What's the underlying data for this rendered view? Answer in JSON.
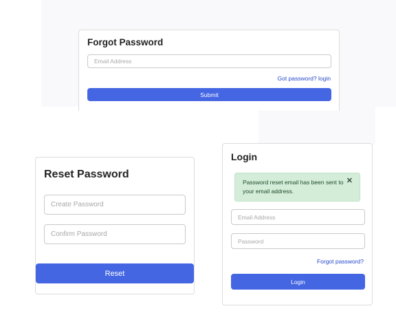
{
  "forgot_password": {
    "title": "Forgot Password",
    "email_placeholder": "Email Address",
    "login_link": "Got password? login",
    "submit_label": "Submit"
  },
  "reset_password": {
    "title": "Reset Password",
    "create_placeholder": "Create Password",
    "confirm_placeholder": "Confirm Password",
    "reset_label": "Reset"
  },
  "login": {
    "title": "Login",
    "alert_message": "Password reset email has been sent to your email address.",
    "alert_close": "✕",
    "email_placeholder": "Email Address",
    "password_placeholder": "Password",
    "forgot_link": "Forgot password?",
    "login_label": "Login"
  },
  "colors": {
    "primary_button": "#4566e3",
    "link": "#2448c7",
    "success_alert_bg": "#d4edd9",
    "card_border": "#dcdcdc"
  },
  "icons": {
    "alert_close": "close-icon"
  }
}
